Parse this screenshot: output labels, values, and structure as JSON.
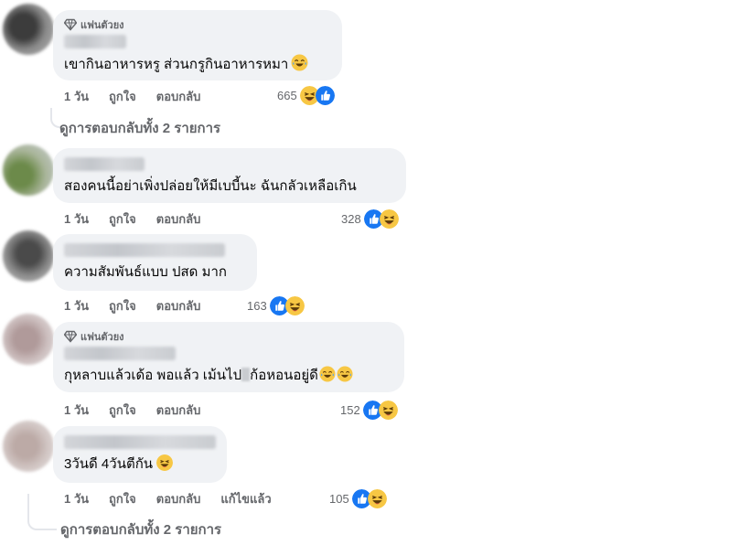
{
  "comments": [
    {
      "badge": "แฟนตัวยง",
      "text": "เขากินอาหารหรู ส่วนกรูกินอาหารหมา",
      "time": "1 วัน",
      "like_label": "ถูกใจ",
      "reply_label": "ตอบกลับ",
      "reaction_count": "665"
    },
    {
      "text": "สองคนนี้อย่าเพิ่งปล่อยให้มีเบบี้นะ ฉันกลัวเหลือเกิน",
      "time": "1 วัน",
      "like_label": "ถูกใจ",
      "reply_label": "ตอบกลับ",
      "reaction_count": "328"
    },
    {
      "text": "ความสัมพันธ์แบบ ปสด มาก",
      "time": "1 วัน",
      "like_label": "ถูกใจ",
      "reply_label": "ตอบกลับ",
      "reaction_count": "163"
    },
    {
      "badge": "แฟนตัวยง",
      "text_a": "กุหลาบแล้วเด้อ พอแล้ว เม้นไป",
      "text_b": "ก้อหอนอยู่ดี",
      "time": "1 วัน",
      "like_label": "ถูกใจ",
      "reply_label": "ตอบกลับ",
      "reaction_count": "152"
    },
    {
      "text": "3วันดี 4วันตีกัน",
      "time": "1 วัน",
      "like_label": "ถูกใจ",
      "reply_label": "ตอบกลับ",
      "edited_label": "แก้ไขแล้ว",
      "reaction_count": "105"
    }
  ],
  "view_replies": [
    "ดูการตอบกลับทั้ง 2 รายการ",
    "ดูการตอบกลับทั้ง 2 รายการ"
  ],
  "colors": {
    "bubble": "#f0f2f5",
    "secondary_text": "#65676b",
    "like_blue": "#1877f2",
    "haha_yellow": "#f7c744"
  },
  "icons": {
    "badge": "diamond-icon",
    "reaction_like": "like-reaction-icon",
    "reaction_haha": "haha-reaction-icon",
    "inline_emoji": "laughing-emoji-icon"
  }
}
